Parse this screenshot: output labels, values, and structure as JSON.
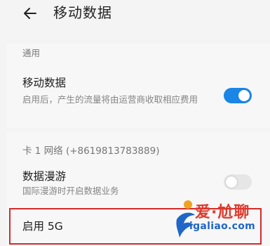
{
  "header": {
    "title": "移动数据",
    "back_icon": "back-arrow-icon"
  },
  "general_section": {
    "label": "通用",
    "mobile_data": {
      "title": "移动数据",
      "subtitle": "启用后，产生的流量将由运营商收取相应费用",
      "toggle_on": true
    }
  },
  "sim_section": {
    "label": "卡 1 网络 (+8619813783889)",
    "data_roaming": {
      "title": "数据漫游",
      "subtitle": "国际漫游时开启数据业务",
      "toggle_on": false
    },
    "enable_5g": {
      "title": "启用 5G"
    }
  },
  "watermark": {
    "brand": "爱·尬聊",
    "url": "igaliao.com"
  },
  "colors": {
    "accent": "#1a86e6",
    "highlight_border": "#d22b2b"
  }
}
